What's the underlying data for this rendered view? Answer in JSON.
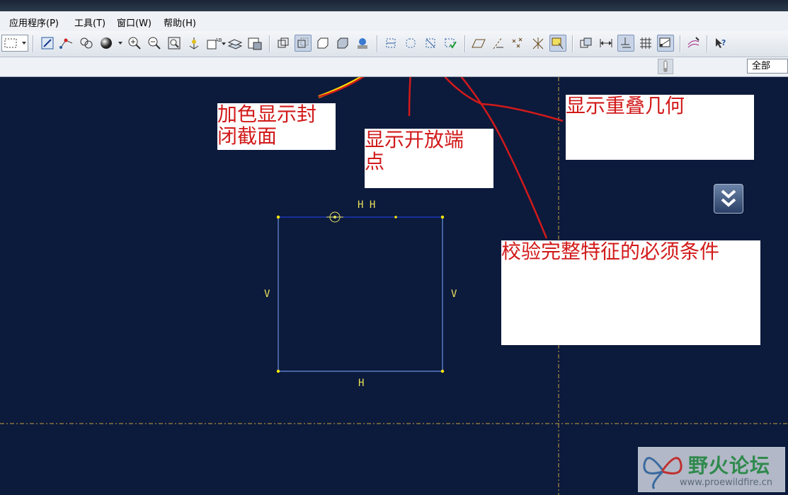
{
  "menubar": {
    "items": [
      {
        "label": "应用程序(P)"
      },
      {
        "label": "工具(T)"
      },
      {
        "label": "窗口(W)"
      },
      {
        "label": "帮助(H)"
      }
    ]
  },
  "toolbar": {
    "icons": [
      "select-box-icon",
      "sketch-icon",
      "datum-point-icon",
      "appearance-icon",
      "shading-sphere-icon",
      "zoom-in-icon",
      "zoom-out-icon",
      "refit-icon",
      "reorient-icon",
      "saved-views-icon",
      "layers-icon",
      "model-display-icon",
      "wireframe-icon",
      "hidden-line-icon",
      "no-hidden-icon",
      "shading-icon",
      "sketcher-display-icon",
      "shade-closed-loops-icon",
      "highlight-open-ends-icon",
      "overlapping-geometry-icon",
      "feature-requirements-icon",
      "plane-display-icon",
      "axis-display-icon",
      "point-display-icon",
      "csys-display-icon",
      "annotation-display-icon",
      "spin-center-icon",
      "dimension-display-icon",
      "constraint-display-icon",
      "grid-display-icon",
      "vertex-display-icon",
      "paint-icon",
      "context-help-icon"
    ]
  },
  "filter": {
    "value": "全部"
  },
  "annotations": {
    "shade_closed": [
      "加色显示封",
      "闭截面"
    ],
    "open_ends": [
      "显示开放端",
      "点"
    ],
    "overlap": [
      "显示重叠几何"
    ],
    "feature_req": [
      "校验完整特征的必须条件"
    ]
  },
  "sketch": {
    "top_label": "H H",
    "left_label": "V",
    "right_label": "V",
    "bottom_label": "H"
  },
  "watermark": {
    "title": "野火论坛",
    "url": "www.proewildfire.cn"
  },
  "colors": {
    "canvas_bg": "#0c1a3c",
    "annotation_red": "#d21a1a",
    "sketch_line": "#1f3fd0",
    "constraint_yellow": "#e8e25a"
  }
}
